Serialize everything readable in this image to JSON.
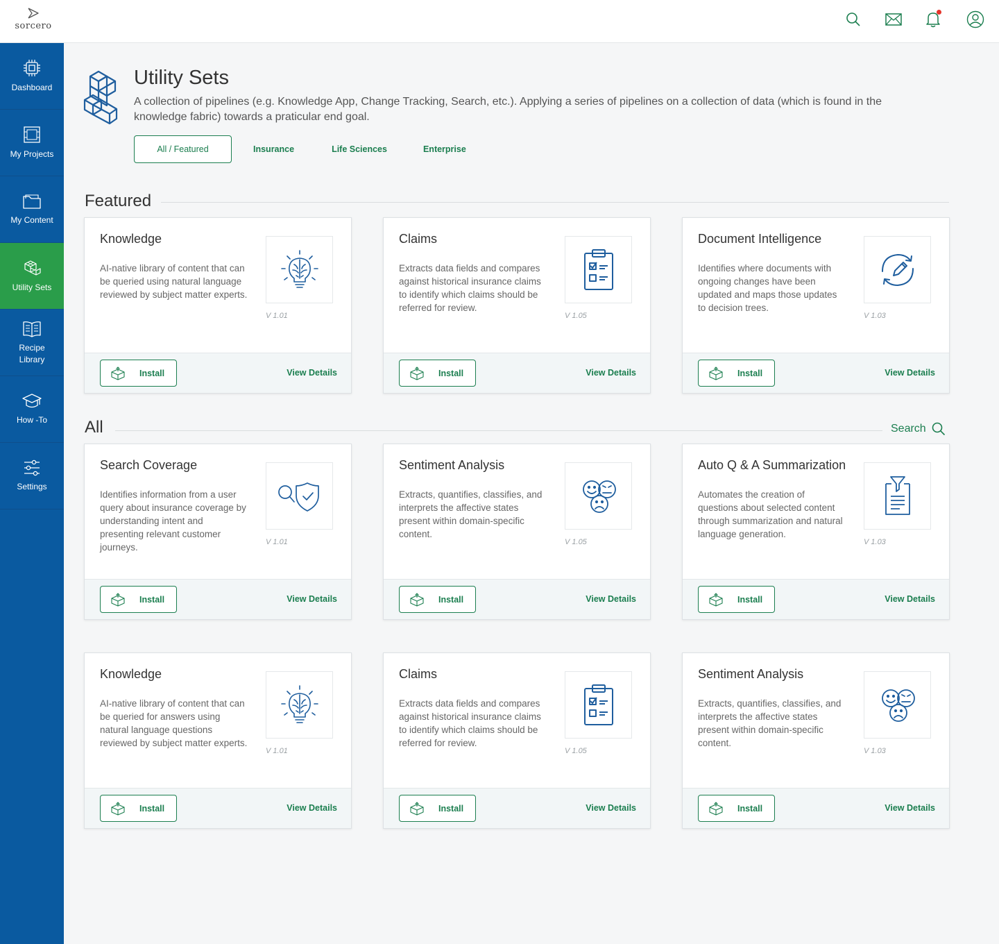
{
  "brand": {
    "name": "sorcero"
  },
  "header": {
    "icons": [
      "search-icon",
      "mail-icon",
      "bell-icon",
      "user-icon"
    ],
    "has_notification": true
  },
  "sidebar": {
    "items": [
      {
        "label": "Dashboard",
        "icon": "chip-icon",
        "active": false
      },
      {
        "label": "My Projects",
        "icon": "blueprint-icon",
        "active": false
      },
      {
        "label": "My Content",
        "icon": "folder-icon",
        "active": false
      },
      {
        "label": "Utility Sets",
        "icon": "cubes-icon",
        "active": true
      },
      {
        "label": "Recipe Library",
        "icon": "book-icon",
        "active": false
      },
      {
        "label": "How -To",
        "icon": "graduation-cap-icon",
        "active": false
      },
      {
        "label": "Settings",
        "icon": "sliders-icon",
        "active": false
      }
    ]
  },
  "page": {
    "title": "Utility Sets",
    "description": "A collection of pipelines (e.g. Knowledge App, Change Tracking, Search, etc.). Applying a series of pipelines on a collection of data (which is found in the knowledge fabric) towards a praticular end goal.",
    "tabs": [
      {
        "label": "All / Featured",
        "active": true
      },
      {
        "label": "Insurance",
        "active": false
      },
      {
        "label": "Life Sciences",
        "active": false
      },
      {
        "label": "Enterprise",
        "active": false
      }
    ]
  },
  "sections": {
    "featured_title": "Featured",
    "all_title": "All",
    "search_label": "Search"
  },
  "actions": {
    "install_label": "Install",
    "details_label": "View Details"
  },
  "cards": [
    {
      "title": "Knowledge",
      "description": "AI-native library of content that can be queried using natural language reviewed by subject matter experts.",
      "version": "V 1.01",
      "icon": "brain-bulb-icon"
    },
    {
      "title": "Claims",
      "description": "Extracts data fields and compares against historical insurance claims to identify which claims should be referred for review.",
      "version": "V 1.05",
      "icon": "clipboard-icon"
    },
    {
      "title": "Document Intelligence",
      "description": "Identifies where documents with ongoing changes have been updated and maps those updates to decision trees.",
      "version": "V 1.03",
      "icon": "refresh-edit-icon"
    },
    {
      "title": "Search Coverage",
      "description": "Identifies information from a user query about insurance coverage by understanding intent and presenting relevant customer journeys.",
      "version": "V 1.01",
      "icon": "search-shield-icon"
    },
    {
      "title": "Sentiment Analysis",
      "description": "Extracts, quantifies, classifies, and interprets the affective states present within domain-specific content.",
      "version": "V 1.05",
      "icon": "faces-icon"
    },
    {
      "title": "Auto Q & A Summarization",
      "description": "Automates the creation of questions about selected content through summarization and natural language generation.",
      "version": "V 1.03",
      "icon": "funnel-doc-icon"
    },
    {
      "title": "Knowledge",
      "description": "AI-native library of content that can be queried for answers using natural language questions reviewed by subject matter experts.",
      "version": "V 1.01",
      "icon": "brain-bulb-icon"
    },
    {
      "title": "Claims",
      "description": "Extracts data fields and compares against historical insurance claims to identify which claims should be referred for review.",
      "version": "V 1.05",
      "icon": "clipboard-icon"
    },
    {
      "title": "Sentiment Analysis",
      "description": "Extracts, quantifies, classifies, and interprets the affective states present within domain-specific content.",
      "version": "V 1.03",
      "icon": "faces-icon"
    }
  ],
  "colors": {
    "sidebar": "#0a5aa0",
    "active": "#2a9d4a",
    "accent_green": "#1b7e4f",
    "icon_blue": "#1f5e9e"
  }
}
